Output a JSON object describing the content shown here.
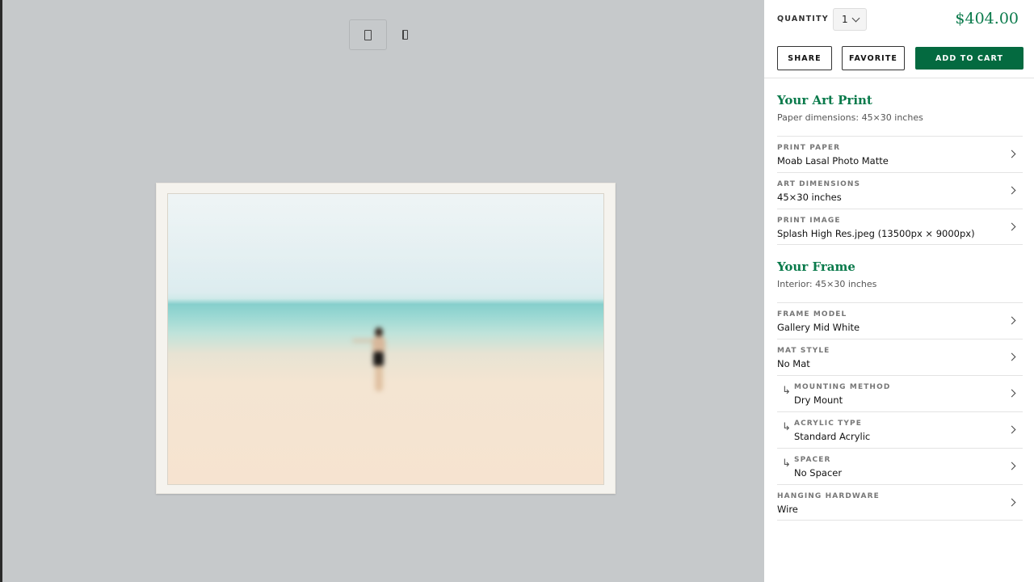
{
  "preview": {
    "view_front_icon": "frame-front-icon",
    "view_side_icon": "frame-side-icon"
  },
  "order": {
    "quantity_label": "QUANTITY",
    "quantity_value": "1",
    "price": "$404.00",
    "share_label": "SHARE",
    "favorite_label": "FAVORITE",
    "add_to_cart_label": "ADD TO CART"
  },
  "art_print": {
    "title": "Your Art Print",
    "subtitle": "Paper dimensions: 45×30 inches",
    "options": [
      {
        "label": "PRINT PAPER",
        "value": "Moab Lasal Photo Matte"
      },
      {
        "label": "ART DIMENSIONS",
        "value": "45×30 inches"
      },
      {
        "label": "PRINT IMAGE",
        "value": "Splash High Res.jpeg (13500px × 9000px)"
      }
    ]
  },
  "frame": {
    "title": "Your Frame",
    "subtitle": "Interior: 45×30 inches",
    "options": [
      {
        "label": "FRAME MODEL",
        "value": "Gallery Mid White"
      },
      {
        "label": "MAT STYLE",
        "value": "No Mat"
      },
      {
        "label": "MOUNTING METHOD",
        "value": "Dry Mount"
      },
      {
        "label": "ACRYLIC TYPE",
        "value": "Standard Acrylic"
      },
      {
        "label": "SPACER",
        "value": "No Spacer"
      },
      {
        "label": "HANGING HARDWARE",
        "value": "Wire"
      }
    ]
  },
  "colors": {
    "accent_green": "#0a7a4b",
    "cart_button": "#046a40",
    "preview_bg": "#c6c9cb"
  }
}
